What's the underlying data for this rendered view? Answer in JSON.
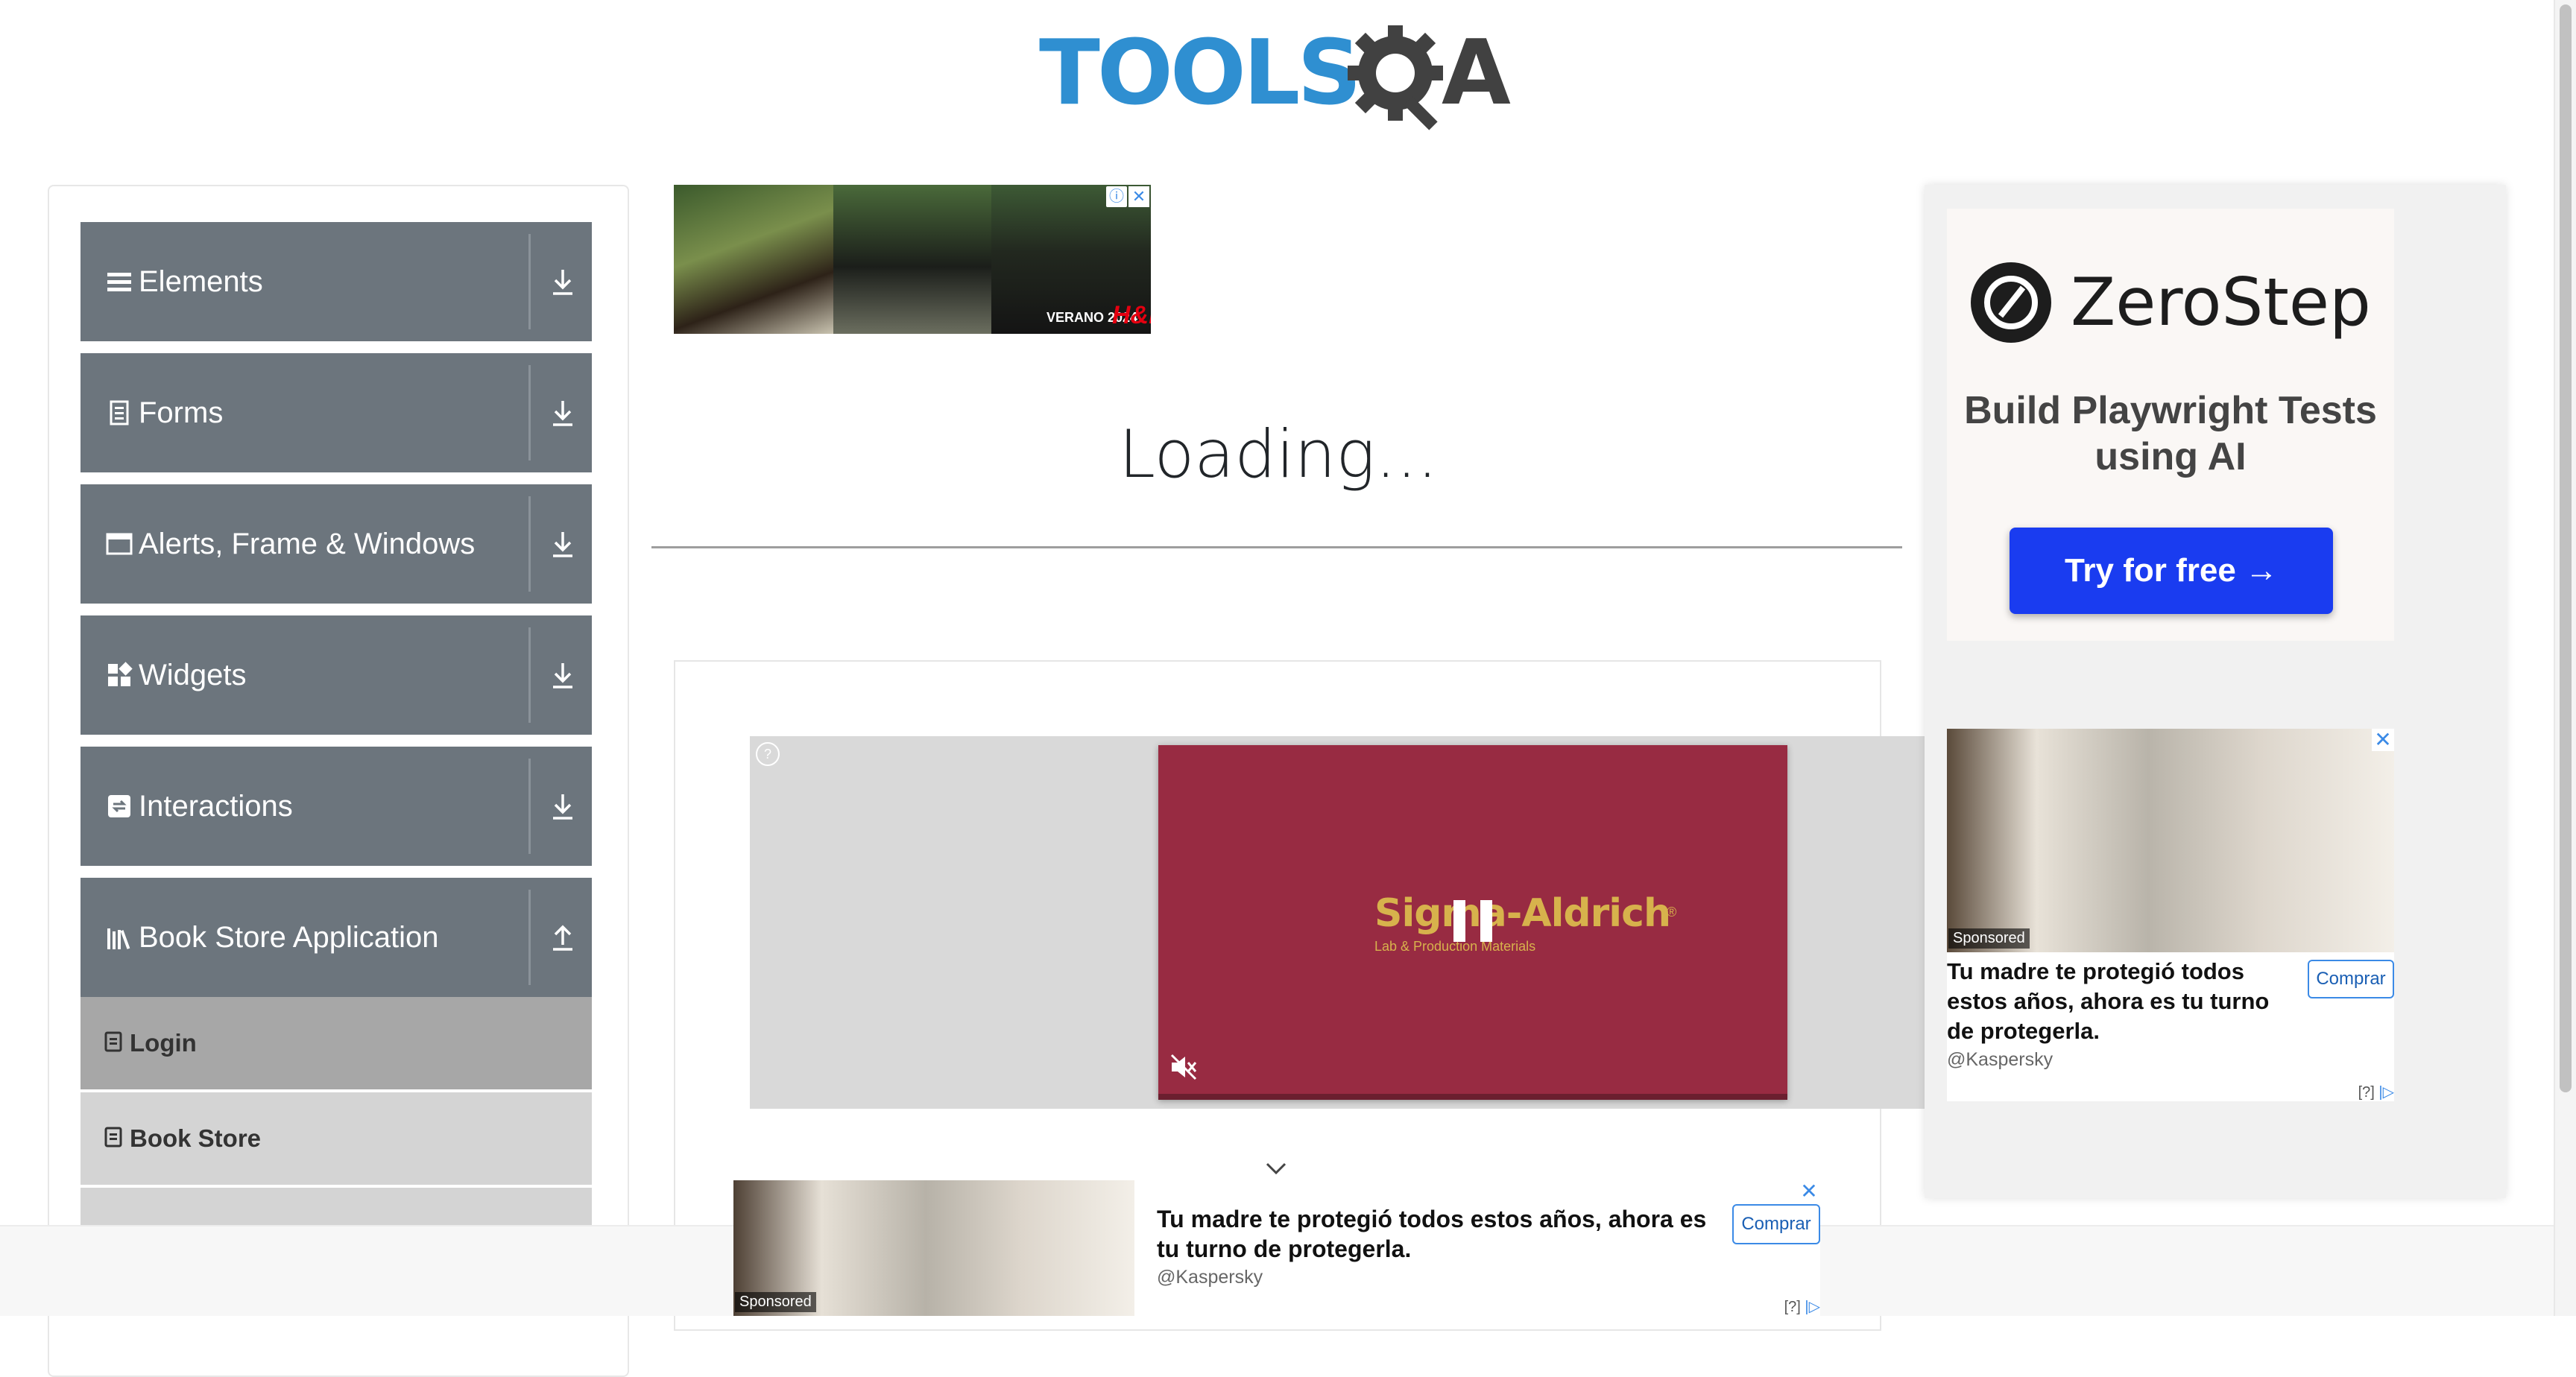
{
  "header": {
    "logo_tools": "TOOLS",
    "logo_a": "A"
  },
  "sidebar": {
    "groups": [
      {
        "label": "Elements",
        "icon": "list-icon",
        "state": "collapsed"
      },
      {
        "label": "Forms",
        "icon": "document-icon",
        "state": "collapsed"
      },
      {
        "label": "Alerts, Frame & Windows",
        "icon": "window-icon",
        "state": "collapsed"
      },
      {
        "label": "Widgets",
        "icon": "widgets-icon",
        "state": "collapsed"
      },
      {
        "label": "Interactions",
        "icon": "interactions-icon",
        "state": "collapsed"
      },
      {
        "label": "Book Store Application",
        "icon": "books-icon",
        "state": "expanded"
      }
    ],
    "items": [
      {
        "label": "Login",
        "active": true
      },
      {
        "label": "Book Store",
        "active": false
      }
    ]
  },
  "top_ad": {
    "caption": "VERANO 2024",
    "brand": "H&M"
  },
  "main": {
    "loading_text": "Loading..."
  },
  "video_ad": {
    "brand": "Sigma-Aldrich",
    "brand_mark": "®",
    "tagline": "Lab & Production Materials",
    "help": "?"
  },
  "zerostep_ad": {
    "name": "ZeroStep",
    "tagline": "Build Playwright Tests using AI",
    "button": "Try for free →"
  },
  "kaspersky_ad": {
    "sponsored": "Sponsored",
    "headline": "Tu madre te protegió todos estos años, ahora es tu turno de protegerla.",
    "source": "@Kaspersky",
    "button": "Comprar",
    "ad_choices": "[?]",
    "close": "✕"
  },
  "colors": {
    "sidebar_header": "#6c757d",
    "logo_blue": "#2f8fd1",
    "video_bg": "#982b42",
    "cta_blue": "#1a3cf0"
  }
}
